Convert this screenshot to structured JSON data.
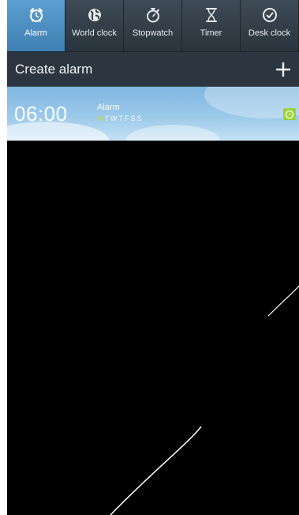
{
  "tabs": [
    {
      "label": "Alarm",
      "icon": "alarm-clock-icon",
      "active": true
    },
    {
      "label": "World clock",
      "icon": "globe-icon",
      "active": false
    },
    {
      "label": "Stopwatch",
      "icon": "stopwatch-icon",
      "active": false
    },
    {
      "label": "Timer",
      "icon": "hourglass-icon",
      "active": false
    },
    {
      "label": "Desk clock",
      "icon": "desk-clock-icon",
      "active": false
    }
  ],
  "create_row": {
    "label": "Create alarm",
    "add_icon": "plus-icon"
  },
  "alarms": [
    {
      "time": "06:00",
      "name": "Alarm",
      "days": [
        {
          "letter": "M",
          "on": true
        },
        {
          "letter": "T",
          "on": false
        },
        {
          "letter": "W",
          "on": false
        },
        {
          "letter": "T",
          "on": false
        },
        {
          "letter": "F",
          "on": false
        },
        {
          "letter": "S",
          "on": false
        },
        {
          "letter": "S",
          "on": false
        }
      ],
      "toggle_icon": "alarm-on-icon"
    }
  ],
  "colors": {
    "active_tab": "#4f8fc3",
    "tab_bar": "#333e48",
    "day_on": "#b8d548",
    "toggle": "#9bd23a"
  }
}
